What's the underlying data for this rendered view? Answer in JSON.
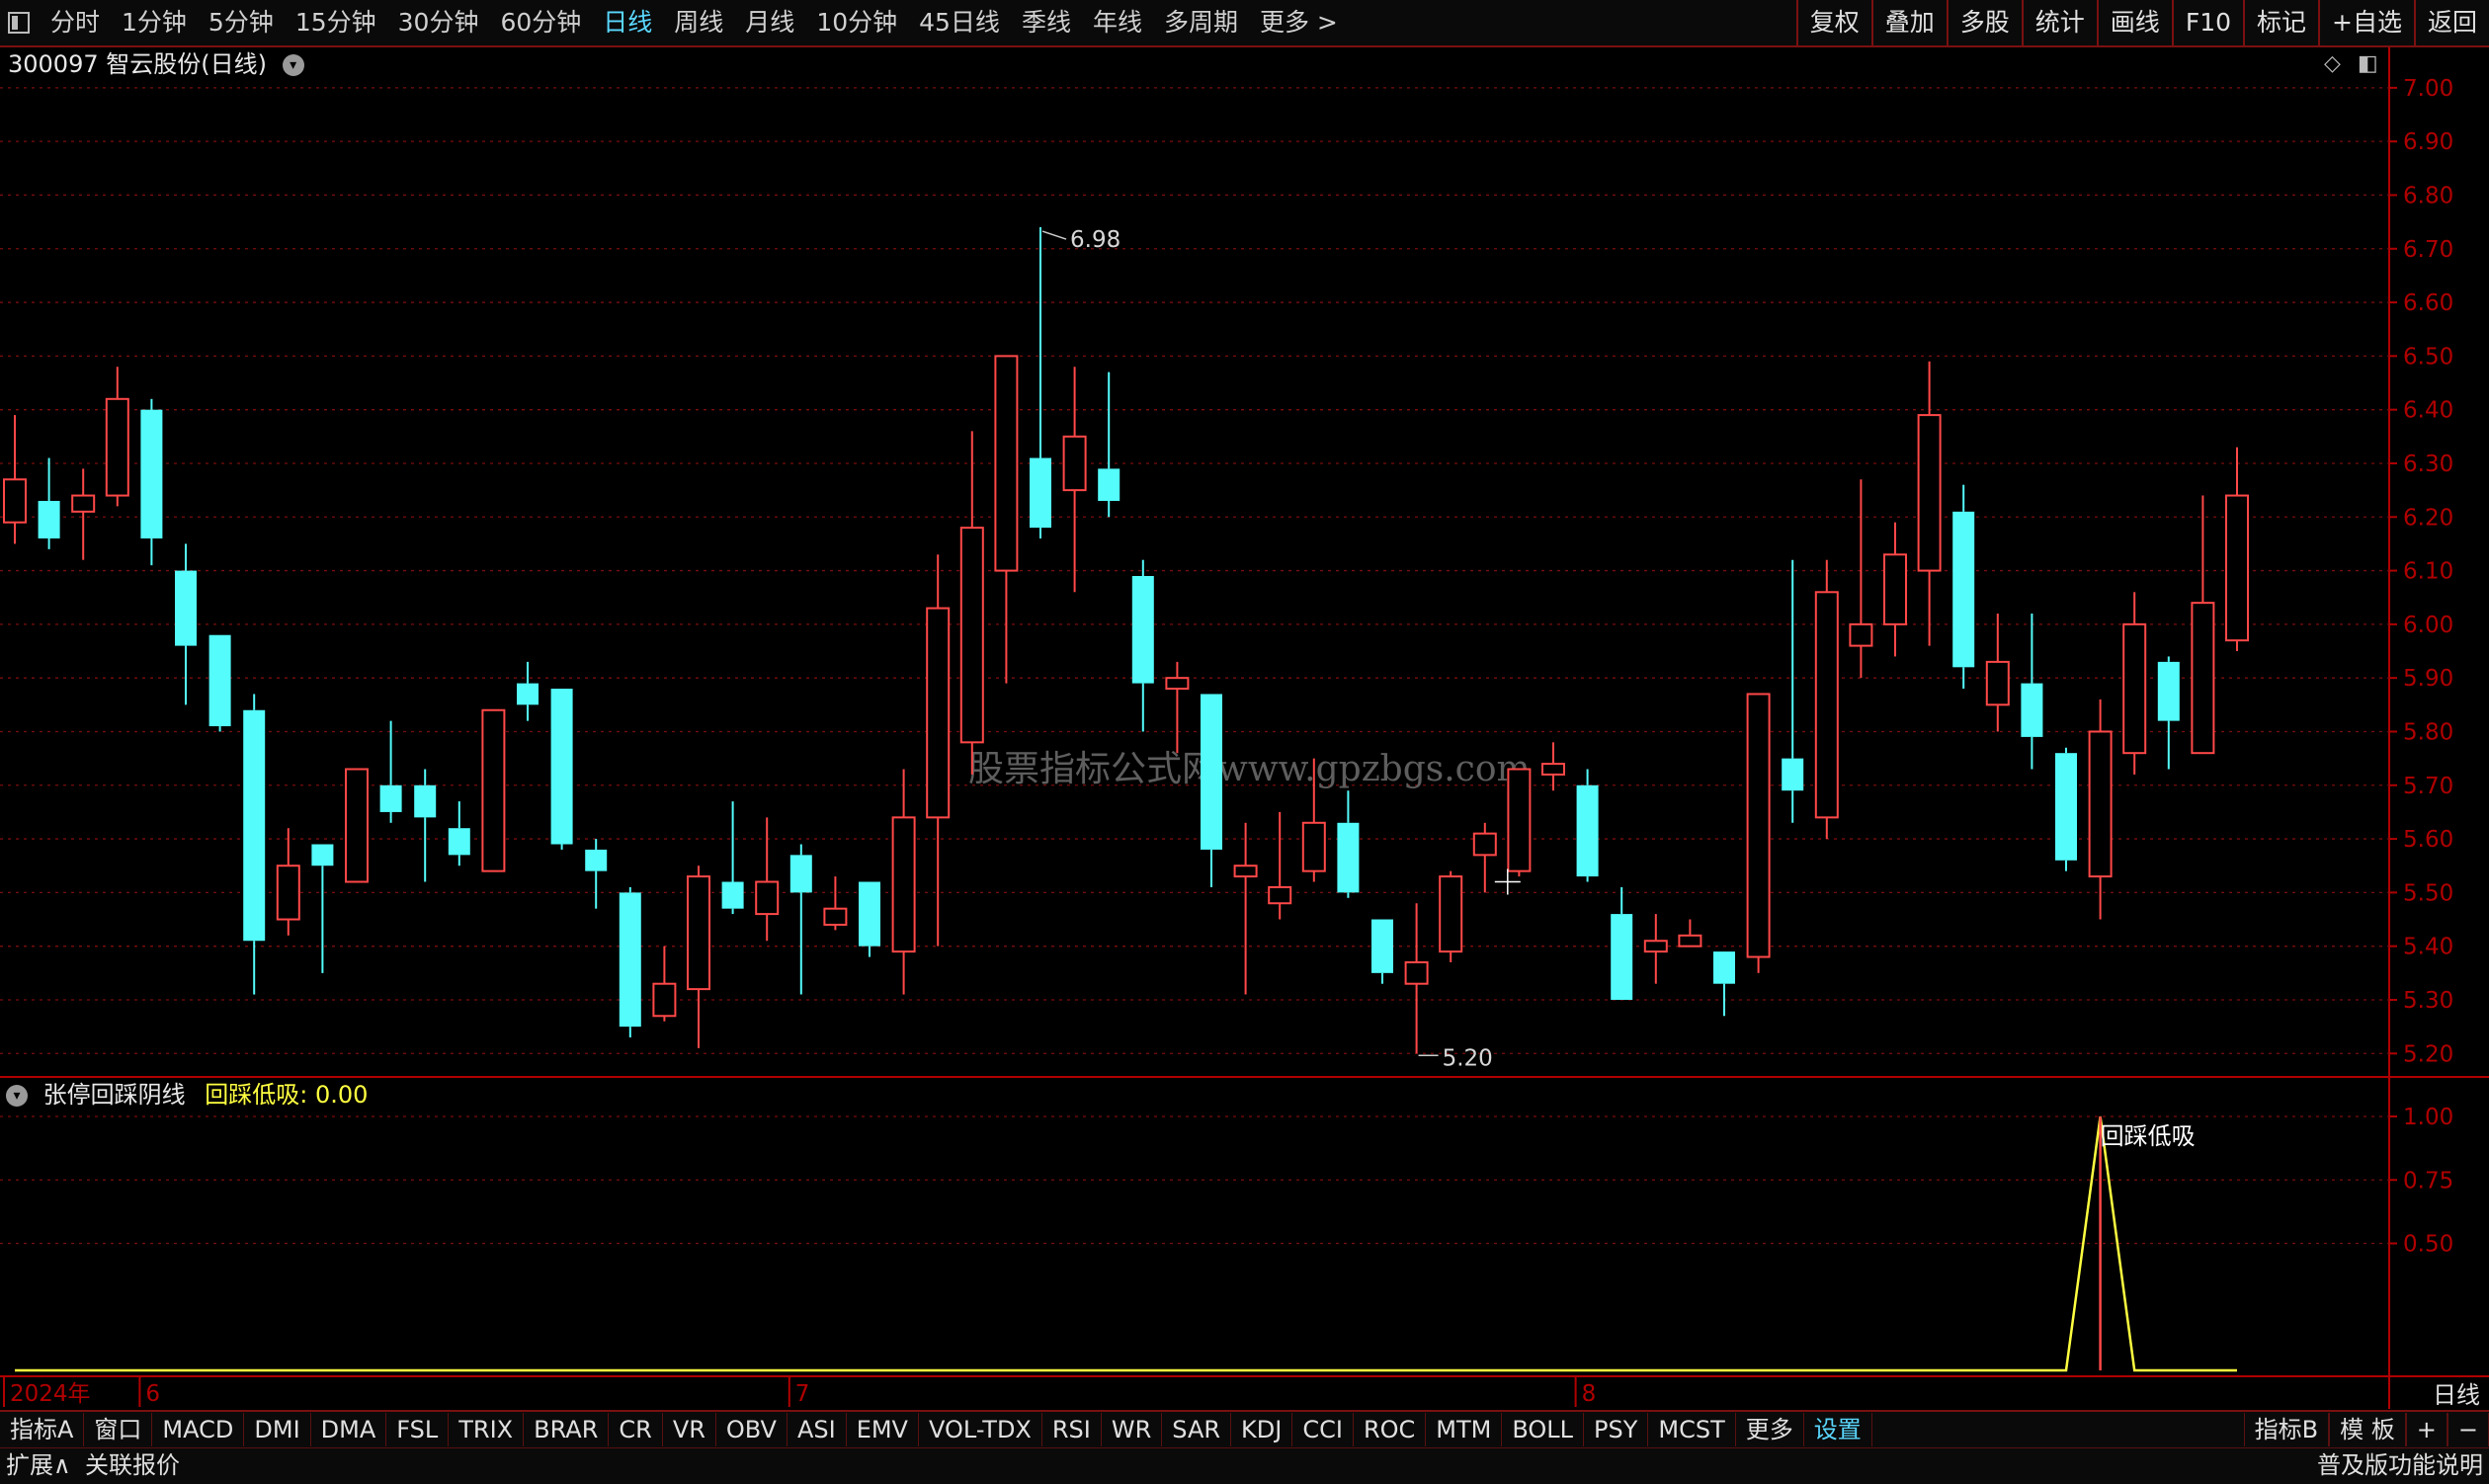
{
  "toolbar": {
    "periods": [
      "分时",
      "1分钟",
      "5分钟",
      "15分钟",
      "30分钟",
      "60分钟",
      "日线",
      "周线",
      "月线",
      "10分钟",
      "45日线",
      "季线",
      "年线",
      "多周期",
      "更多 >"
    ],
    "active_period": "日线",
    "right_buttons": [
      "复权",
      "叠加",
      "多股",
      "统计",
      "画线",
      "F10",
      "标记",
      "+自选",
      "返回"
    ]
  },
  "stock": {
    "code": "300097",
    "name": "智云股份",
    "period_label": "(日线)"
  },
  "indicator": {
    "name": "张停回踩阴线",
    "value_label": "回踩低吸:",
    "value": "0.00",
    "annotation": "回踩低吸"
  },
  "watermark": "股票指标公式网www.gpzbgs.com",
  "chart_data": [
    {
      "type": "candlestick",
      "price_axis": {
        "ticks": [
          "7.00",
          "6.90",
          "6.80",
          "6.70",
          "6.60",
          "6.50",
          "6.40",
          "6.30",
          "6.20",
          "6.10",
          "6.00",
          "5.90",
          "5.80",
          "5.70",
          "5.60",
          "5.50",
          "5.40",
          "5.30",
          "5.20"
        ],
        "ylim": [
          5.16,
          7.02
        ]
      },
      "max_label": "6.98",
      "min_label": "5.20",
      "x_labels": [
        "2024年",
        "6",
        "7",
        "8"
      ],
      "x_label_index": [
        0,
        4,
        23,
        46
      ],
      "candles": [
        [
          6.19,
          6.27,
          6.15,
          6.39
        ],
        [
          6.23,
          6.16,
          6.14,
          6.31
        ],
        [
          6.21,
          6.24,
          6.12,
          6.29
        ],
        [
          6.24,
          6.42,
          6.22,
          6.48
        ],
        [
          6.4,
          6.16,
          6.11,
          6.42
        ],
        [
          6.1,
          5.96,
          5.85,
          6.15
        ],
        [
          5.98,
          5.81,
          5.8,
          5.98
        ],
        [
          5.84,
          5.41,
          5.31,
          5.87
        ],
        [
          5.45,
          5.55,
          5.42,
          5.62
        ],
        [
          5.59,
          5.55,
          5.35,
          5.59
        ],
        [
          5.52,
          5.73,
          5.52,
          5.73
        ],
        [
          5.7,
          5.65,
          5.63,
          5.82
        ],
        [
          5.7,
          5.64,
          5.52,
          5.73
        ],
        [
          5.62,
          5.57,
          5.55,
          5.67
        ],
        [
          5.54,
          5.84,
          5.54,
          5.84
        ],
        [
          5.89,
          5.85,
          5.82,
          5.93
        ],
        [
          5.88,
          5.59,
          5.58,
          5.88
        ],
        [
          5.58,
          5.54,
          5.47,
          5.6
        ],
        [
          5.5,
          5.25,
          5.23,
          5.51
        ],
        [
          5.27,
          5.33,
          5.26,
          5.4
        ],
        [
          5.32,
          5.53,
          5.21,
          5.55
        ],
        [
          5.52,
          5.47,
          5.46,
          5.67
        ],
        [
          5.46,
          5.52,
          5.41,
          5.64
        ],
        [
          5.57,
          5.5,
          5.31,
          5.59
        ],
        [
          5.44,
          5.47,
          5.43,
          5.53
        ],
        [
          5.52,
          5.4,
          5.38,
          5.52
        ],
        [
          5.39,
          5.64,
          5.31,
          5.73
        ],
        [
          5.64,
          6.03,
          5.4,
          6.13
        ],
        [
          5.78,
          6.18,
          5.72,
          6.36
        ],
        [
          6.1,
          6.5,
          5.89,
          6.5
        ],
        [
          6.31,
          6.18,
          6.16,
          6.74
        ],
        [
          6.25,
          6.35,
          6.06,
          6.48
        ],
        [
          6.29,
          6.23,
          6.2,
          6.47
        ],
        [
          6.09,
          5.89,
          5.8,
          6.12
        ],
        [
          5.88,
          5.9,
          5.76,
          5.93
        ],
        [
          5.87,
          5.58,
          5.51,
          5.87
        ],
        [
          5.53,
          5.55,
          5.31,
          5.63
        ],
        [
          5.48,
          5.51,
          5.45,
          5.65
        ],
        [
          5.54,
          5.63,
          5.52,
          5.75
        ],
        [
          5.63,
          5.5,
          5.49,
          5.69
        ],
        [
          5.45,
          5.35,
          5.33,
          5.45
        ],
        [
          5.33,
          5.37,
          5.2,
          5.48
        ],
        [
          5.39,
          5.53,
          5.37,
          5.54
        ],
        [
          5.57,
          5.61,
          5.5,
          5.63
        ],
        [
          5.54,
          5.73,
          5.53,
          5.73
        ],
        [
          5.72,
          5.74,
          5.69,
          5.78
        ],
        [
          5.7,
          5.53,
          5.52,
          5.73
        ],
        [
          5.46,
          5.3,
          5.3,
          5.51
        ],
        [
          5.39,
          5.41,
          5.33,
          5.46
        ],
        [
          5.4,
          5.42,
          5.4,
          5.45
        ],
        [
          5.39,
          5.33,
          5.27,
          5.39
        ],
        [
          5.38,
          5.87,
          5.35,
          5.87
        ],
        [
          5.75,
          5.69,
          5.63,
          6.12
        ],
        [
          5.64,
          6.06,
          5.6,
          6.12
        ],
        [
          5.96,
          6.0,
          5.9,
          6.27
        ],
        [
          6.0,
          6.13,
          5.94,
          6.19
        ],
        [
          6.1,
          6.39,
          5.96,
          6.49
        ],
        [
          6.21,
          5.92,
          5.88,
          6.26
        ],
        [
          5.85,
          5.93,
          5.8,
          6.02
        ],
        [
          5.89,
          5.79,
          5.73,
          6.02
        ],
        [
          5.76,
          5.56,
          5.54,
          5.77
        ],
        [
          5.53,
          5.8,
          5.45,
          5.86
        ],
        [
          5.76,
          6.0,
          5.72,
          6.06
        ],
        [
          5.93,
          5.82,
          5.73,
          5.94
        ],
        [
          5.76,
          6.04,
          5.76,
          6.24
        ],
        [
          5.97,
          6.24,
          5.95,
          6.33
        ]
      ]
    },
    {
      "type": "line",
      "name": "回踩低吸",
      "yaxis_ticks": [
        "1.00",
        "0.75",
        "0.50"
      ],
      "ylim": [
        0,
        1
      ],
      "spike_index": 61,
      "values": [
        0,
        0,
        0,
        0,
        0,
        0,
        0,
        0,
        0,
        0,
        0,
        0,
        0,
        0,
        0,
        0,
        0,
        0,
        0,
        0,
        0,
        0,
        0,
        0,
        0,
        0,
        0,
        0,
        0,
        0,
        0,
        0,
        0,
        0,
        0,
        0,
        0,
        0,
        0,
        0,
        0,
        0,
        0,
        0,
        0,
        0,
        0,
        0,
        0,
        0,
        0,
        0,
        0,
        0,
        0,
        0,
        0,
        0,
        0,
        0,
        0,
        1,
        0,
        0,
        0,
        0
      ]
    }
  ],
  "bottom": {
    "indicators": [
      "指标A",
      "窗口",
      "MACD",
      "DMI",
      "DMA",
      "FSL",
      "TRIX",
      "BRAR",
      "CR",
      "VR",
      "OBV",
      "ASI",
      "EMV",
      "VOL-TDX",
      "RSI",
      "WR",
      "SAR",
      "KDJ",
      "CCI",
      "ROC",
      "MTM",
      "BOLL",
      "PSY",
      "MCST",
      "更多",
      "设置"
    ],
    "highlight": "设置",
    "right": [
      "指标B",
      "模 板",
      "+",
      "−"
    ],
    "row2_left": [
      "扩展∧",
      "关联报价"
    ],
    "row2_right": "普及版功能说明",
    "period_label": "日线"
  },
  "colors": {
    "up": "#ff4848",
    "down": "#54fcfc",
    "axis": "#b00000",
    "indicator": "#ffff40"
  }
}
